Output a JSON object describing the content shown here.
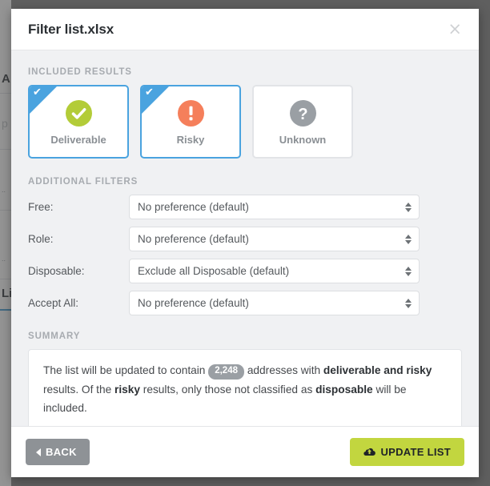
{
  "modal": {
    "title": "Filter list.xlsx",
    "close_icon": "close-icon",
    "close_label": "×"
  },
  "included_results": {
    "section_label": "INCLUDED RESULTS",
    "cards": [
      {
        "label": "Deliverable",
        "icon": "check-circle-icon",
        "selected": true,
        "color": "#b3cc38"
      },
      {
        "label": "Risky",
        "icon": "exclamation-circle-icon",
        "selected": true,
        "color": "#f57f5b"
      },
      {
        "label": "Unknown",
        "icon": "question-circle-icon",
        "selected": false,
        "color": "#9a9fa4"
      }
    ],
    "selected_corner_icon": "check-icon"
  },
  "additional_filters": {
    "section_label": "ADDITIONAL FILTERS",
    "rows": [
      {
        "label": "Free:",
        "value": "No preference (default)"
      },
      {
        "label": "Role:",
        "value": "No preference (default)"
      },
      {
        "label": "Disposable:",
        "value": "Exclude all Disposable (default)"
      },
      {
        "label": "Accept All:",
        "value": "No preference (default)"
      }
    ],
    "dropdown_icon": "select-arrows-icon"
  },
  "summary": {
    "section_label": "SUMMARY",
    "text_part_1": "The list will be updated to contain",
    "count": "2,248",
    "text_part_2": "addresses with",
    "emphasis_1": "deliverable and risky",
    "text_part_3": "results. Of the",
    "emphasis_2": "risky",
    "text_part_4": "results, only those not classified as",
    "emphasis_3": "disposable",
    "text_part_5": "will be included."
  },
  "footer": {
    "back_label": "BACK",
    "back_icon": "chevron-left-icon",
    "update_label": "UPDATE LIST",
    "update_icon": "cloud-upload-icon"
  },
  "colors": {
    "accent_blue": "#4aa3df",
    "deliverable_green": "#b3cc38",
    "risky_orange": "#f57f5b",
    "unknown_gray": "#9a9fa4",
    "update_button": "#c2d63f",
    "back_button": "#8e9296",
    "modal_body": "#f0f1f3"
  },
  "background_page": {
    "fragment_1": "A",
    "fragment_2": "p",
    "fragment_3": "..",
    "fragment_4": "..",
    "fragment_5": "Li"
  }
}
